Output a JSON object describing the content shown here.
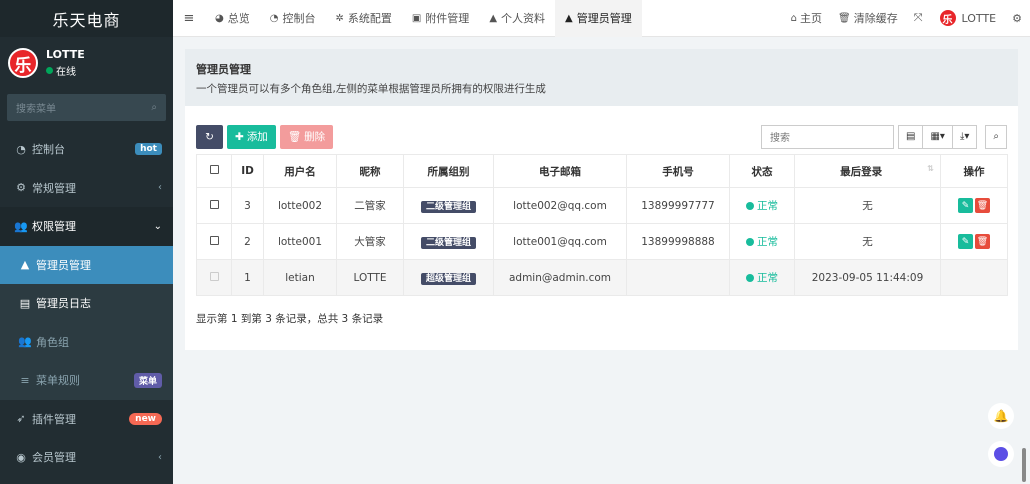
{
  "sidebar": {
    "brand": "乐天电商",
    "user": {
      "avatar": "乐",
      "name": "LOTTE",
      "status": "在线"
    },
    "search_placeholder": "搜索菜单",
    "items": [
      {
        "label": "控制台",
        "badge": "hot"
      },
      {
        "label": "常规管理",
        "chevron": "‹"
      },
      {
        "label": "权限管理",
        "chevron": "⌄"
      },
      {
        "label": "管理员管理"
      },
      {
        "label": "管理员日志"
      },
      {
        "label": "角色组"
      },
      {
        "label": "菜单规则",
        "badge": "菜单"
      },
      {
        "label": "插件管理",
        "badge": "new"
      },
      {
        "label": "会员管理",
        "chevron": "‹"
      }
    ]
  },
  "topbar": {
    "tabs": [
      "总览",
      "控制台",
      "系统配置",
      "附件管理",
      "个人资料",
      "管理员管理"
    ],
    "home": "主页",
    "clear_cache": "清除缓存",
    "user_name": "LOTTE",
    "avatar": "乐"
  },
  "panel": {
    "title": "管理员管理",
    "description": "一个管理员可以有多个角色组,左侧的菜单根据管理员所拥有的权限进行生成",
    "add_label": "添加",
    "delete_label": "删除",
    "search_placeholder": "搜索"
  },
  "table": {
    "headers": [
      "ID",
      "用户名",
      "昵称",
      "所属组别",
      "电子邮箱",
      "手机号",
      "状态",
      "最后登录",
      "操作"
    ],
    "rows": [
      {
        "id": "3",
        "username": "lotte002",
        "nickname": "二管家",
        "group": "二级管理组",
        "email": "lotte002@qq.com",
        "phone": "13899997777",
        "status": "正常",
        "last_login": "无"
      },
      {
        "id": "2",
        "username": "lotte001",
        "nickname": "大管家",
        "group": "二级管理组",
        "email": "lotte001@qq.com",
        "phone": "13899998888",
        "status": "正常",
        "last_login": "无"
      },
      {
        "id": "1",
        "username": "letian",
        "nickname": "LOTTE",
        "group": "超级管理组",
        "email": "admin@admin.com",
        "phone": "",
        "status": "正常",
        "last_login": "2023-09-05 11:44:09"
      }
    ]
  },
  "pager": {
    "info": "显示第 1 到第 3 条记录，总共 3 条记录"
  },
  "colors": {
    "sidebar_bg": "#222d32",
    "active": "#3c8dbc",
    "success": "#18bc9c",
    "danger": "#e74c3c"
  }
}
